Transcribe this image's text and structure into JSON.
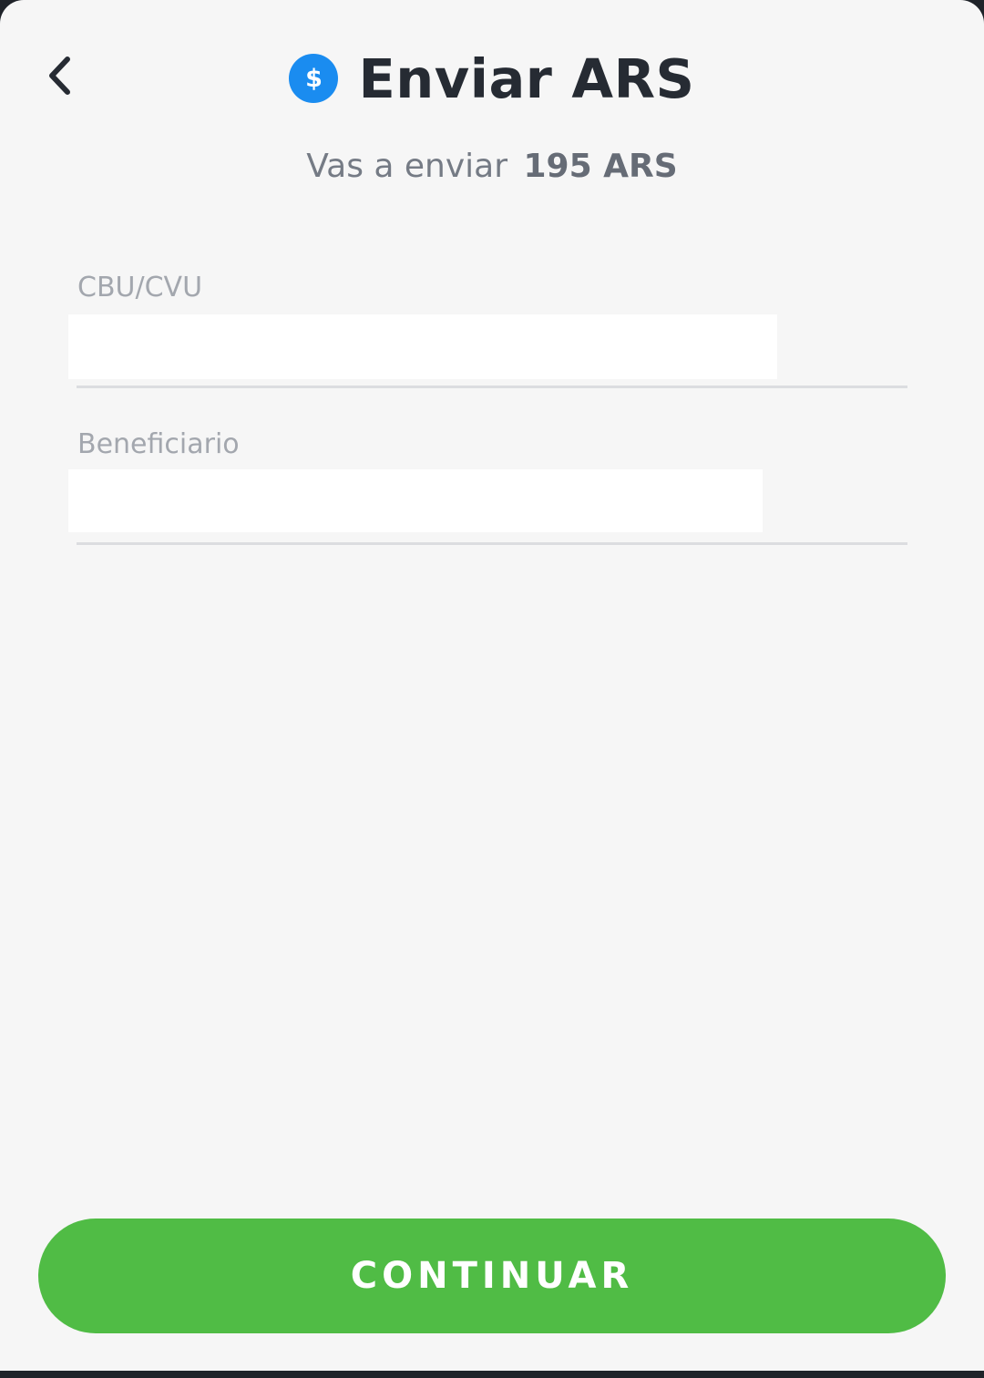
{
  "header": {
    "back_icon": "chevron-left-icon",
    "coin_icon": "dollar-coin-icon",
    "coin_symbol": "$",
    "title": "Enviar ARS"
  },
  "summary": {
    "prefix": "Vas a enviar",
    "amount": "195 ARS"
  },
  "form": {
    "cbu": {
      "label": "CBU/CVU",
      "value": ""
    },
    "beneficiary": {
      "label": "Beneficiario",
      "value": ""
    }
  },
  "footer": {
    "continue_label": "CONTINUAR"
  },
  "colors": {
    "background": "#f6f6f6",
    "accent_blue": "#1a8cf0",
    "primary_green": "#50bc45",
    "title_text": "#262b33",
    "label_gray": "#a3a7ae"
  }
}
